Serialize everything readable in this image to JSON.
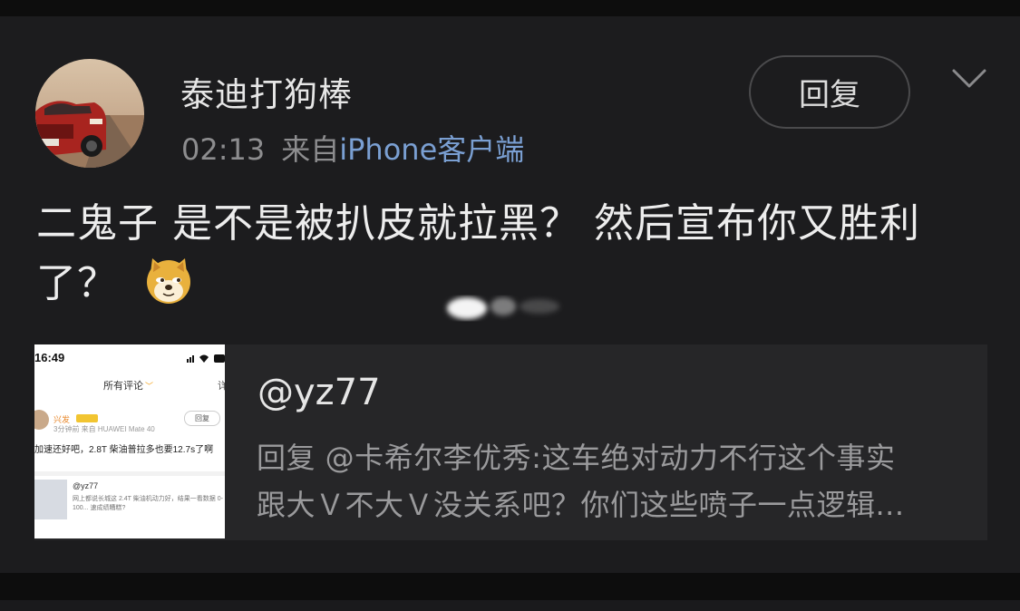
{
  "post": {
    "author": "泰迪打狗棒",
    "time": "02:13",
    "source_prefix": "来自",
    "source_link": "iPhone客户端",
    "reply_label": "回复",
    "text_line1": "二鬼子 是不是被扒皮就拉黑？ 然后宣布你又胜利",
    "text_line2": "了？",
    "emoji_icon": "doge-emoji-icon"
  },
  "quote": {
    "handle": "@yz77",
    "line1": "回复 @卡希尔李优秀:这车绝对动力不行这个事实",
    "line2": "跟大Ｖ不大Ｖ没关系吧？你们这些喷子一点逻辑...",
    "thumbnail": {
      "time": "16:49",
      "tab": "所有评论",
      "corner": "详",
      "name": "兴发",
      "sub": "3分钟前  来自 HUAWEI Mate 40",
      "reply": "回复",
      "body": "加速还好吧，2.8T 柴油普拉多也要12.7s了啊",
      "quoted_handle": "@yz77",
      "quoted_text": "网上都说长城这 2.4T 柴油机动力好，结果一看数据 0-100...  速成绩糟糕?"
    }
  },
  "colors": {
    "background": "#121212",
    "card": "#1c1c1e",
    "quote_card": "#262628",
    "link": "#7a9fd2",
    "muted": "#8d8d8f"
  }
}
